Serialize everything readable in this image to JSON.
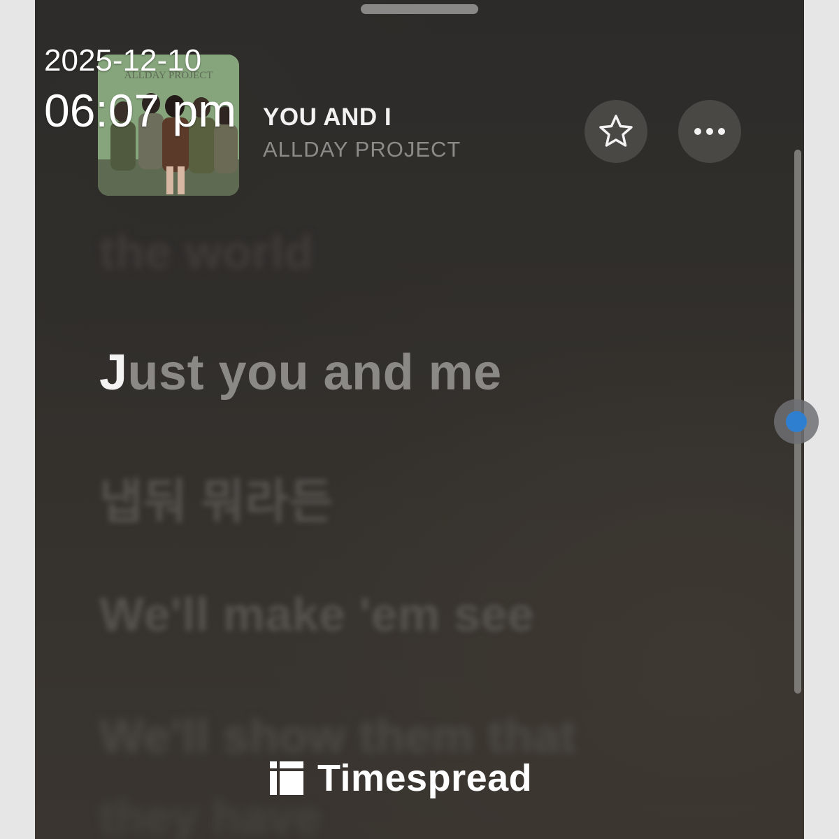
{
  "now_playing": {
    "title": "YOU AND I",
    "artist": "ALLDAY PROJECT",
    "artwork_label": "ALLDAY PROJECT",
    "favorite_icon": "star-icon",
    "more_icon": "more-horizontal-icon"
  },
  "lyrics": [
    {
      "text": "the world",
      "state": "past"
    },
    {
      "text": "Just you and me",
      "state": "current",
      "sung": "J",
      "unsung": "ust you and me"
    },
    {
      "text": "냅둬 뭐라든",
      "state": "upcoming"
    },
    {
      "text": "We'll make 'em see",
      "state": "upcoming"
    },
    {
      "text": "We'll show them that",
      "state": "upcoming"
    },
    {
      "text": "they have",
      "state": "upcoming"
    }
  ],
  "overlay": {
    "date": "2025-12-10",
    "time": "06:07 pm"
  },
  "watermark": {
    "brand": "Timespread",
    "icon": "timespread-logo-icon"
  },
  "colors": {
    "accent_dot": "#2f7fd1",
    "background": "#2e2c2a"
  }
}
